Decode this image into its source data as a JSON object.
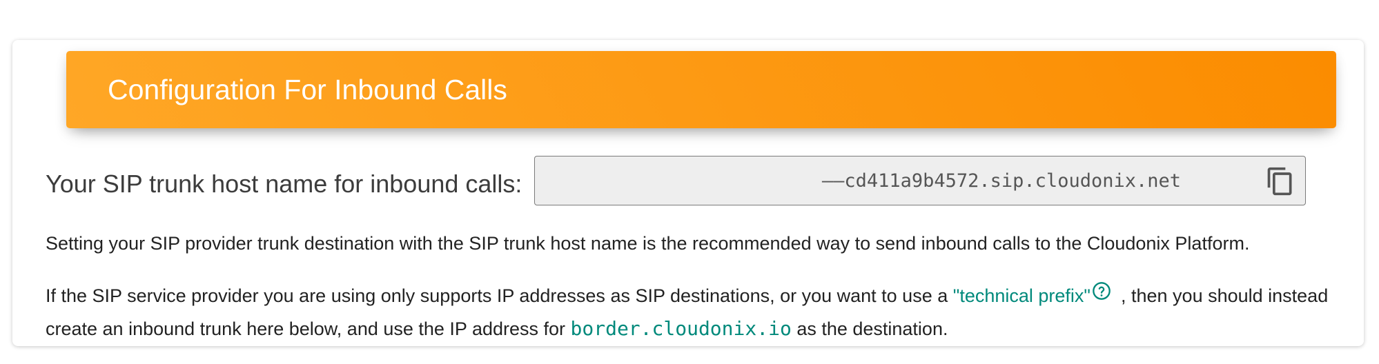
{
  "card": {
    "title": "Configuration For Inbound Calls",
    "header_gradient": [
      "#ffa726",
      "#fb8c00"
    ]
  },
  "host": {
    "label": "Your SIP trunk host name for inbound calls:",
    "value": "——cd411a9b4572.sip.cloudonix.net",
    "copy_icon": "copy-icon"
  },
  "text": {
    "para1": "Setting your SIP provider trunk destination with the SIP trunk host name is the recommended way to send inbound calls to the Cloudonix Platform.",
    "para2_before_link": "If the SIP service provider you are using only supports IP addresses as SIP destinations, or you want to use a ",
    "para2_link": "\"technical prefix\"",
    "para2_help_icon": "help-circle-icon",
    "para2_after_link": ", then you should instead create an inbound trunk here below, and use the IP address for ",
    "para2_code": "border.cloudonix.io",
    "para2_end": " as the destination."
  },
  "colors": {
    "accent": "#00897b",
    "header": "#fb8c00"
  }
}
